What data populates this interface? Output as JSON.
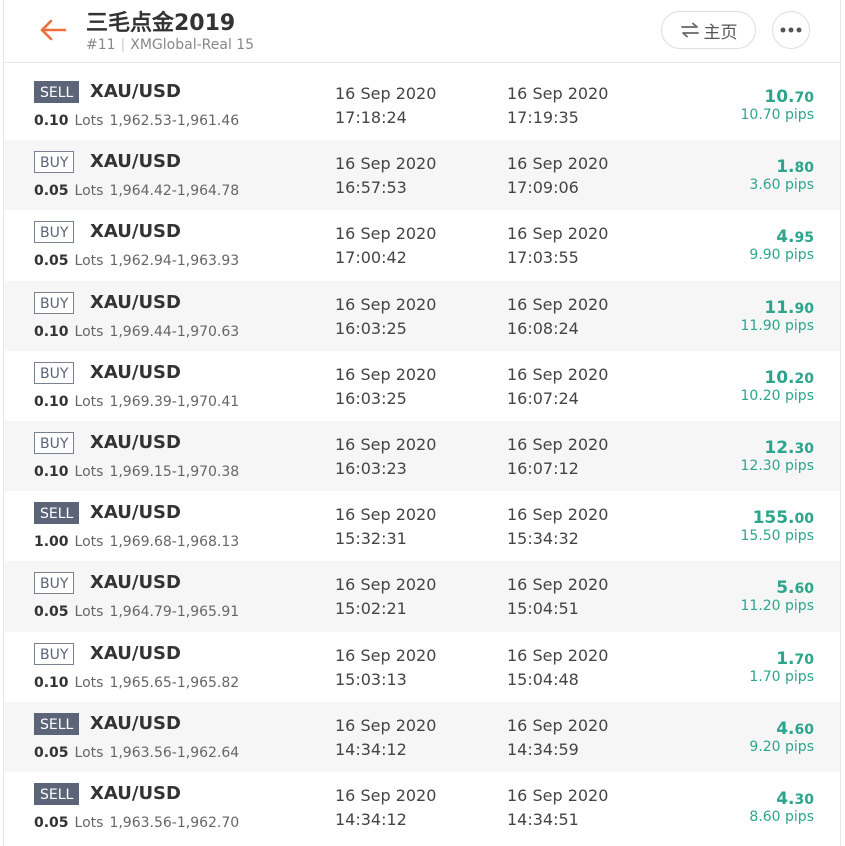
{
  "header": {
    "title": "三毛点金2019",
    "rank": "#11",
    "account": "XMGlobal-Real 15",
    "home_label": "主页",
    "back_icon": "back-arrow-icon",
    "swap_icon": "swap-arrows-icon",
    "more_icon": "more-dots-icon",
    "accent_color": "#f26b3a"
  },
  "colors": {
    "profit": "#2ca58d",
    "sell_badge": "#5b6478"
  },
  "units": {
    "lots": "Lots",
    "pips": "pips"
  },
  "trades": [
    {
      "side": "SELL",
      "symbol": "XAU/USD",
      "lots": "0.10",
      "prices": "1,962.53-1,961.46",
      "open_date": "16 Sep 2020",
      "open_time": "17:18:24",
      "close_date": "16 Sep 2020",
      "close_time": "17:19:35",
      "profit_int": "10.",
      "profit_dec": "70",
      "pips": "10.70 pips"
    },
    {
      "side": "BUY",
      "symbol": "XAU/USD",
      "lots": "0.05",
      "prices": "1,964.42-1,964.78",
      "open_date": "16 Sep 2020",
      "open_time": "16:57:53",
      "close_date": "16 Sep 2020",
      "close_time": "17:09:06",
      "profit_int": "1.",
      "profit_dec": "80",
      "pips": "3.60 pips"
    },
    {
      "side": "BUY",
      "symbol": "XAU/USD",
      "lots": "0.05",
      "prices": "1,962.94-1,963.93",
      "open_date": "16 Sep 2020",
      "open_time": "17:00:42",
      "close_date": "16 Sep 2020",
      "close_time": "17:03:55",
      "profit_int": "4.",
      "profit_dec": "95",
      "pips": "9.90 pips"
    },
    {
      "side": "BUY",
      "symbol": "XAU/USD",
      "lots": "0.10",
      "prices": "1,969.44-1,970.63",
      "open_date": "16 Sep 2020",
      "open_time": "16:03:25",
      "close_date": "16 Sep 2020",
      "close_time": "16:08:24",
      "profit_int": "11.",
      "profit_dec": "90",
      "pips": "11.90 pips"
    },
    {
      "side": "BUY",
      "symbol": "XAU/USD",
      "lots": "0.10",
      "prices": "1,969.39-1,970.41",
      "open_date": "16 Sep 2020",
      "open_time": "16:03:25",
      "close_date": "16 Sep 2020",
      "close_time": "16:07:24",
      "profit_int": "10.",
      "profit_dec": "20",
      "pips": "10.20 pips"
    },
    {
      "side": "BUY",
      "symbol": "XAU/USD",
      "lots": "0.10",
      "prices": "1,969.15-1,970.38",
      "open_date": "16 Sep 2020",
      "open_time": "16:03:23",
      "close_date": "16 Sep 2020",
      "close_time": "16:07:12",
      "profit_int": "12.",
      "profit_dec": "30",
      "pips": "12.30 pips"
    },
    {
      "side": "SELL",
      "symbol": "XAU/USD",
      "lots": "1.00",
      "prices": "1,969.68-1,968.13",
      "open_date": "16 Sep 2020",
      "open_time": "15:32:31",
      "close_date": "16 Sep 2020",
      "close_time": "15:34:32",
      "profit_int": "155.",
      "profit_dec": "00",
      "pips": "15.50 pips"
    },
    {
      "side": "BUY",
      "symbol": "XAU/USD",
      "lots": "0.05",
      "prices": "1,964.79-1,965.91",
      "open_date": "16 Sep 2020",
      "open_time": "15:02:21",
      "close_date": "16 Sep 2020",
      "close_time": "15:04:51",
      "profit_int": "5.",
      "profit_dec": "60",
      "pips": "11.20 pips"
    },
    {
      "side": "BUY",
      "symbol": "XAU/USD",
      "lots": "0.10",
      "prices": "1,965.65-1,965.82",
      "open_date": "16 Sep 2020",
      "open_time": "15:03:13",
      "close_date": "16 Sep 2020",
      "close_time": "15:04:48",
      "profit_int": "1.",
      "profit_dec": "70",
      "pips": "1.70 pips"
    },
    {
      "side": "SELL",
      "symbol": "XAU/USD",
      "lots": "0.05",
      "prices": "1,963.56-1,962.64",
      "open_date": "16 Sep 2020",
      "open_time": "14:34:12",
      "close_date": "16 Sep 2020",
      "close_time": "14:34:59",
      "profit_int": "4.",
      "profit_dec": "60",
      "pips": "9.20 pips"
    },
    {
      "side": "SELL",
      "symbol": "XAU/USD",
      "lots": "0.05",
      "prices": "1,963.56-1,962.70",
      "open_date": "16 Sep 2020",
      "open_time": "14:34:12",
      "close_date": "16 Sep 2020",
      "close_time": "14:34:51",
      "profit_int": "4.",
      "profit_dec": "30",
      "pips": "8.60 pips"
    }
  ]
}
